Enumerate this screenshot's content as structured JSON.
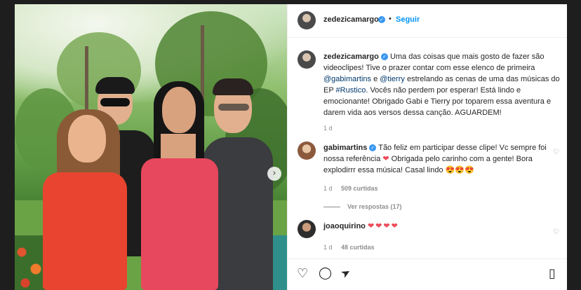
{
  "post": {
    "username": "zedezicamargo",
    "follow_label": "Seguir",
    "caption_username": "zedezicamargo",
    "caption_parts": [
      "Uma das coisas que mais gosto de fazer são videoclipes! Tive o prazer contar com esse elenco de primeira ",
      "@gabimartins",
      " e ",
      "@tierry",
      " estrelando as cenas de uma das músicas do EP ",
      "#Rustico",
      ". Vocês não perdem por esperar! Está lindo e emocionante! Obrigado Gabi e Tierry por toparem essa aventura e darem vida aos versos dessa canção. AGUARDEM!"
    ],
    "caption_time": "1 d"
  },
  "comments": [
    {
      "username": "gabimartins",
      "text_a": "Tão feliz em participar desse clipe! Vc sempre foi nossa referência ",
      "heart": "❤",
      "text_b": " Obrigada pelo carinho com a gente! Bora explodirrr essa música! Casal lindo ",
      "emojis": "😍😍😍",
      "time": "1 d",
      "likes": "509 curtidas",
      "replies": "Ver respostas (17)"
    },
    {
      "username": "joaoquirino",
      "hearts": "❤❤❤❤",
      "time": "1 d",
      "likes": "48 curtidas"
    }
  ],
  "icons": {
    "next": "›",
    "verified": "✓",
    "heart_outline": "♡",
    "comment": "◯",
    "share": "➤",
    "bookmark": "▯"
  },
  "colors": {
    "link": "#0095f6",
    "verified": "#3897f0",
    "heart": "#ed4956"
  }
}
